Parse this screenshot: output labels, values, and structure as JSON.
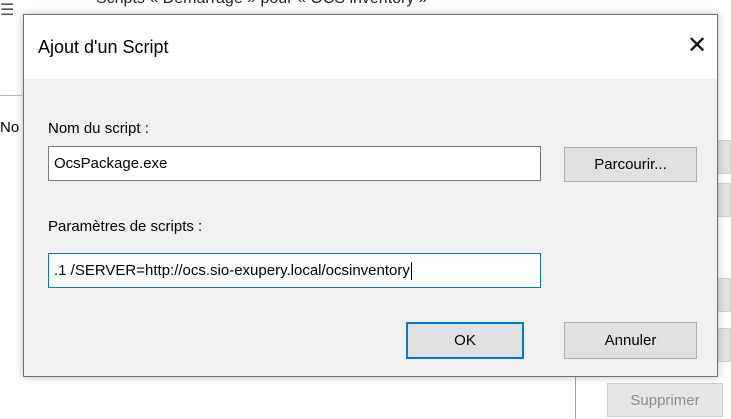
{
  "background": {
    "window_title": "Scripts « Démarrage » pour « OCS inventory »",
    "partial_label": "No",
    "delete_button_label": "Supprimer"
  },
  "dialog": {
    "title": "Ajout d'un Script",
    "script_name_label": "Nom du script :",
    "script_name_value": "OcsPackage.exe",
    "browse_button_label": "Parcourir...",
    "script_params_label": "Paramètres de scripts :",
    "script_params_value": ".1 /SERVER=http://ocs.sio-exupery.local/ocsinventory",
    "ok_button_label": "OK",
    "cancel_button_label": "Annuler"
  },
  "colors": {
    "accent": "#0078d7",
    "button_face": "#e1e1e1",
    "dialog_bg": "#f0f0f0"
  }
}
